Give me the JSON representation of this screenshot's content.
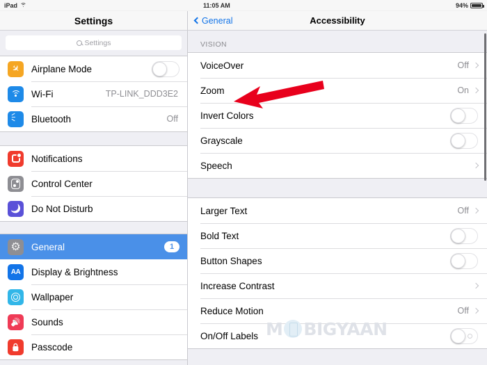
{
  "status_bar": {
    "device": "iPad",
    "wifi_icon": "wifi-icon",
    "time": "11:05 AM",
    "battery_percent": "94%",
    "battery_icon": "battery-icon"
  },
  "sidebar": {
    "title": "Settings",
    "search": {
      "placeholder": "Settings",
      "icon": "search-icon",
      "value": ""
    },
    "groups": [
      {
        "items": [
          {
            "label": "Airplane Mode",
            "icon": "airplane-icon",
            "control": "toggle",
            "toggle_on": false
          },
          {
            "label": "Wi-Fi",
            "icon": "wifi-icon",
            "control": "value",
            "value": "TP-LINK_DDD3E2"
          },
          {
            "label": "Bluetooth",
            "icon": "bluetooth-icon",
            "control": "value",
            "value": "Off"
          }
        ]
      },
      {
        "items": [
          {
            "label": "Notifications",
            "icon": "notifications-icon",
            "control": "none"
          },
          {
            "label": "Control Center",
            "icon": "control-center-icon",
            "control": "none"
          },
          {
            "label": "Do Not Disturb",
            "icon": "moon-icon",
            "control": "none"
          }
        ]
      },
      {
        "items": [
          {
            "label": "General",
            "icon": "gear-icon",
            "control": "badge",
            "badge": "1",
            "selected": true
          },
          {
            "label": "Display & Brightness",
            "icon": "display-icon",
            "control": "none"
          },
          {
            "label": "Wallpaper",
            "icon": "wallpaper-icon",
            "control": "none"
          },
          {
            "label": "Sounds",
            "icon": "sounds-icon",
            "control": "none"
          },
          {
            "label": "Passcode",
            "icon": "passcode-icon",
            "control": "none"
          }
        ]
      }
    ]
  },
  "detail": {
    "back_label": "General",
    "back_icon": "chevron-left-icon",
    "title": "Accessibility",
    "sections": [
      {
        "header": "VISION",
        "rows": [
          {
            "label": "VoiceOver",
            "control": "value",
            "value": "Off",
            "chevron": true
          },
          {
            "label": "Zoom",
            "control": "value",
            "value": "On",
            "chevron": true,
            "annotated": true
          },
          {
            "label": "Invert Colors",
            "control": "toggle",
            "toggle_on": false
          },
          {
            "label": "Grayscale",
            "control": "toggle",
            "toggle_on": false
          },
          {
            "label": "Speech",
            "control": "chevron",
            "chevron": true
          }
        ]
      },
      {
        "header": "",
        "rows": [
          {
            "label": "Larger Text",
            "control": "value",
            "value": "Off",
            "chevron": true
          },
          {
            "label": "Bold Text",
            "control": "toggle",
            "toggle_on": false
          },
          {
            "label": "Button Shapes",
            "control": "toggle",
            "toggle_on": false
          },
          {
            "label": "Increase Contrast",
            "control": "chevron",
            "chevron": true
          },
          {
            "label": "Reduce Motion",
            "control": "value",
            "value": "Off",
            "chevron": true
          },
          {
            "label": "On/Off Labels",
            "control": "toggle",
            "toggle_on": false,
            "off_mark": true
          }
        ]
      }
    ]
  },
  "annotation": {
    "type": "arrow",
    "direction": "left",
    "color": "#e8001c",
    "points_at": "Zoom"
  },
  "watermark": {
    "text_before": "M",
    "text_after": "BIGYAAN",
    "icon": "phone-icon"
  },
  "colors": {
    "accent": "#1274e8",
    "selection": "#4a90e8",
    "arrow": "#e8001c",
    "background": "#efeff4"
  }
}
